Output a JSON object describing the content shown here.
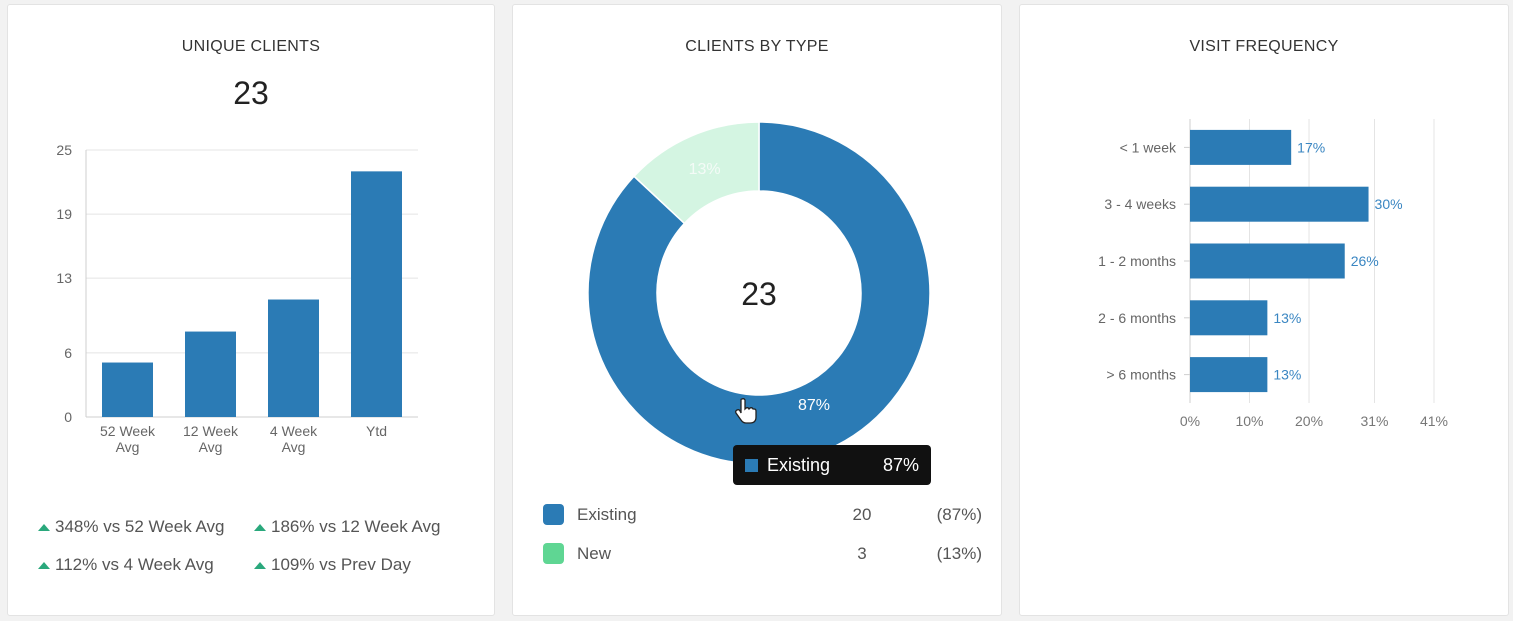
{
  "unique_clients": {
    "title": "UNIQUE CLIENTS",
    "total": "23",
    "comparisons": [
      "348% vs 52 Week Avg",
      "186% vs 12 Week Avg",
      "112% vs 4 Week Avg",
      "109% vs Prev Day"
    ],
    "trend_icon": "up-triangle-icon"
  },
  "clients_by_type": {
    "title": "CLIENTS BY TYPE",
    "center_value": "23",
    "tooltip": {
      "label": "Existing",
      "value": "87%"
    },
    "legend": [
      {
        "name": "Existing",
        "count": "20",
        "pct": "(87%)",
        "color": "#2b7bb5"
      },
      {
        "name": "New",
        "count": "3",
        "pct": "(13%)",
        "color": "#5fd693"
      }
    ]
  },
  "visit_frequency": {
    "title": "VISIT FREQUENCY"
  },
  "colors": {
    "bar": "#2b7bb5",
    "existing": "#2b7bb5",
    "new_slice": "#d4f5e2",
    "new_legend": "#5fd693",
    "up_trend": "#2aa87c",
    "value_label": "#3a86c2"
  },
  "chart_data": [
    {
      "type": "bar",
      "title": "UNIQUE CLIENTS",
      "categories": [
        "52 Week Avg",
        "12 Week Avg",
        "4 Week Avg",
        "Ytd"
      ],
      "category_lines": [
        [
          "52 Week",
          "Avg"
        ],
        [
          "12 Week",
          "Avg"
        ],
        [
          "4 Week",
          "Avg"
        ],
        [
          "Ytd"
        ]
      ],
      "values": [
        5.1,
        8.0,
        11.0,
        23
      ],
      "ylim": [
        0,
        25
      ],
      "yticks": [
        0,
        6,
        13,
        19,
        25
      ],
      "grid": true
    },
    {
      "type": "pie",
      "title": "CLIENTS BY TYPE",
      "donut": true,
      "labels": [
        "Existing",
        "New"
      ],
      "values": [
        20,
        3
      ],
      "slice_labels": [
        "87%",
        "13%"
      ],
      "colors": [
        "#2b7bb5",
        "#d4f5e2"
      ]
    },
    {
      "type": "bar",
      "orientation": "horizontal",
      "title": "VISIT FREQUENCY",
      "categories": [
        "< 1 week",
        "3 - 4 weeks",
        "1 - 2 months",
        "2 - 6 months",
        "> 6 months"
      ],
      "values": [
        17,
        30,
        26,
        13,
        13
      ],
      "value_labels": [
        "17%",
        "30%",
        "26%",
        "13%",
        "13%"
      ],
      "xlim": [
        0,
        41
      ],
      "xticks": [
        0,
        10,
        20,
        31,
        41
      ],
      "xtick_labels": [
        "0%",
        "10%",
        "20%",
        "31%",
        "41%"
      ],
      "grid": true
    }
  ]
}
